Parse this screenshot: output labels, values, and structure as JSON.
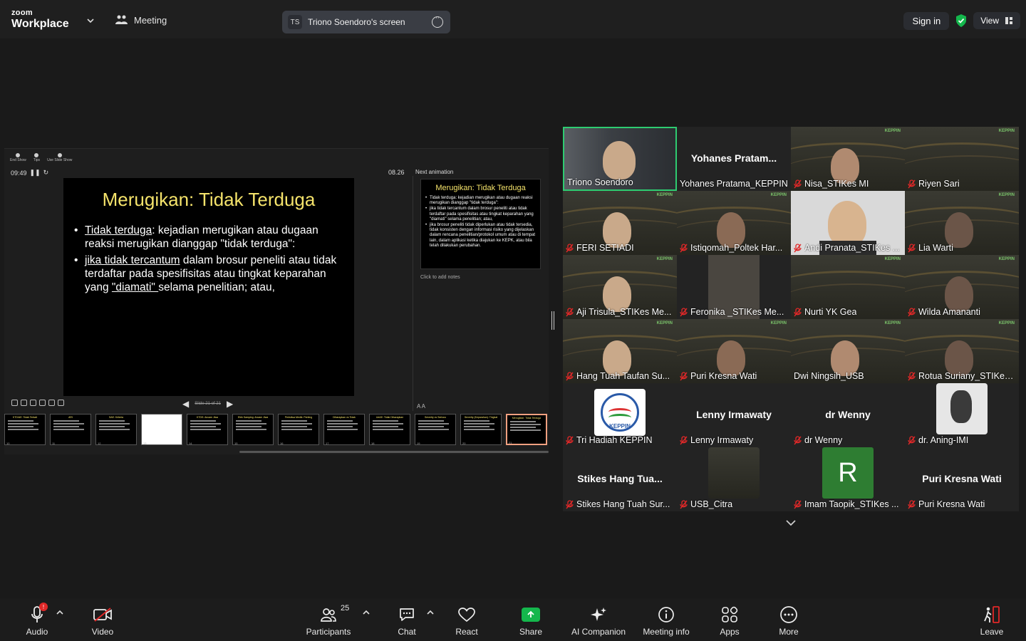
{
  "topbar": {
    "logo_top": "zoom",
    "logo_bottom": "Workplace",
    "meeting_label": "Meeting",
    "screen_initials": "TS",
    "screen_label": "Triono Soendoro's screen",
    "signin_label": "Sign in",
    "view_label": "View"
  },
  "presenter": {
    "tools": [
      "End Show",
      "Tips",
      "Use Slide Show"
    ],
    "elapsed": "09:49",
    "clock": "08.26",
    "next_label": "Next animation",
    "notes_placeholder": "Click to add notes",
    "slide_count": "Slide 21 of 21",
    "slide": {
      "title": "Merugikan: Tidak Terduga",
      "b1_u": "Tidak terduga",
      "b1_rest": ": kejadian merugikan atau dugaan reaksi merugikan dianggap \"tidak terduga\":",
      "b2_u": "jika tidak tercantum",
      "b2_mid": " dalam brosur peneliti atau tidak terdaftar pada spesifisitas atau tingkat keparahan yang ",
      "b2_u2": "\"diamati\" ",
      "b2_end": "selama penelitian; atau,"
    },
    "next_slide": {
      "title": "Merugikan: Tidak Terduga",
      "p1": "Tidak terduga: kejadian merugikan atau dugaan reaksi merugikan dianggap \"tidak terduga\":",
      "p2": "jika tidak tercantum dalam brosur peneliti atau tidak terdaftar pada spesifisitas atau tingkat keparahan yang \"diamati\" selama penelitian; atau,",
      "p3": "jika brosur peneliti tidak diperlukan atau tidak tersedia, tidak konsisten dengan informasi risiko yang dijelaskan dalam rencana penelitian/protokol umum atau di tempat lain, dalam aplikasi ketika diajukan ke KEPK, atau bila telah dilakukan perubahan."
    },
    "thumbnails": [
      {
        "title": "KTD/AE: Tidak Terkait",
        "num": "10"
      },
      {
        "title": "ARI",
        "num": "11"
      },
      {
        "title": "SAE: Kriteria",
        "num": "12"
      },
      {
        "title": "",
        "num": "13"
      },
      {
        "title": "KTDS: Ancam Jiwa",
        "num": "14"
      },
      {
        "title": "Efek Samping: Ancam Jiwa",
        "num": "15"
      },
      {
        "title": "Peristiwa Medik: Penting",
        "num": "16"
      },
      {
        "title": "Diharapkan vs Tidak",
        "num": "17"
      },
      {
        "title": "UeAE: Tidak Diharapkan",
        "num": "18"
      },
      {
        "title": "Severity vs Serious",
        "num": "19"
      },
      {
        "title": "Severity (Keparahan): Tingkat",
        "num": "20"
      },
      {
        "title": "Merugikan: Tidak Terduga",
        "num": "21"
      }
    ]
  },
  "gallery": [
    {
      "name": "Triono Soendoro",
      "big": "",
      "muted": false,
      "active": true,
      "kind": "video"
    },
    {
      "name": "Yohanes Pratama_KEPPIN",
      "big": "Yohanes  Pratam...",
      "muted": false,
      "kind": "name"
    },
    {
      "name": "Nisa_STIKes MI",
      "big": "",
      "muted": true,
      "kind": "banner-person"
    },
    {
      "name": "Riyen Sari",
      "big": "",
      "muted": true,
      "kind": "banner"
    },
    {
      "name": "FERI SETIADI",
      "big": "",
      "muted": true,
      "kind": "banner-person"
    },
    {
      "name": "Istiqomah_Poltek Har...",
      "big": "",
      "muted": true,
      "kind": "banner-person"
    },
    {
      "name": "Andi Pranata_STIKes ...",
      "big": "",
      "muted": true,
      "kind": "video"
    },
    {
      "name": "Lia Warti",
      "big": "",
      "muted": true,
      "kind": "banner-person"
    },
    {
      "name": "Aji Trisula_STIKes Me...",
      "big": "",
      "muted": true,
      "kind": "banner-person"
    },
    {
      "name": "Feronika _STIKes Me...",
      "big": "",
      "muted": true,
      "kind": "dark"
    },
    {
      "name": "Nurti YK Gea",
      "big": "",
      "muted": true,
      "kind": "banner"
    },
    {
      "name": "Wilda Amananti",
      "big": "",
      "muted": true,
      "kind": "banner-person"
    },
    {
      "name": "Hang Tuah Taufan Su...",
      "big": "",
      "muted": true,
      "kind": "banner-person"
    },
    {
      "name": "Puri Kresna Wati",
      "big": "",
      "muted": true,
      "kind": "banner-person"
    },
    {
      "name": "Dwi Ningsih_USB",
      "big": "",
      "muted": false,
      "kind": "banner-person"
    },
    {
      "name": "Rotua Suriany_STIKes...",
      "big": "",
      "muted": true,
      "kind": "banner-person"
    },
    {
      "name": "Tri Hadiah KEPPIN",
      "big": "",
      "muted": true,
      "kind": "logo"
    },
    {
      "name": "Lenny Irmawaty",
      "big": "Lenny  Irmawaty",
      "muted": true,
      "kind": "name"
    },
    {
      "name": "dr Wenny",
      "big": "dr Wenny",
      "muted": true,
      "kind": "name"
    },
    {
      "name": "dr. Aning-IMI",
      "big": "",
      "muted": true,
      "kind": "avatar-photo"
    },
    {
      "name": "Stikes Hang Tuah Sur...",
      "big": "Stikes  Hang  Tua...",
      "muted": true,
      "kind": "name"
    },
    {
      "name": "USB_Citra",
      "big": "",
      "muted": true,
      "kind": "avatar-banner"
    },
    {
      "name": "Imam Taopik_STIKes ...",
      "big": "",
      "muted": true,
      "kind": "avatar-letter",
      "letter": "R"
    },
    {
      "name": "Puri Kresna Wati",
      "big": "Puri Kresna Wati",
      "muted": true,
      "kind": "name"
    }
  ],
  "toolbar": {
    "audio": "Audio",
    "audio_badge": "!",
    "video": "Video",
    "participants": "Participants",
    "participants_count": "25",
    "chat": "Chat",
    "react": "React",
    "share": "Share",
    "ai": "AI Companion",
    "info": "Meeting info",
    "apps": "Apps",
    "more": "More",
    "leave": "Leave"
  },
  "colors": {
    "accent_green": "#14b74c",
    "active_speaker": "#2ecc71",
    "muted_red": "#e02828",
    "slide_title": "#f5e36b"
  }
}
